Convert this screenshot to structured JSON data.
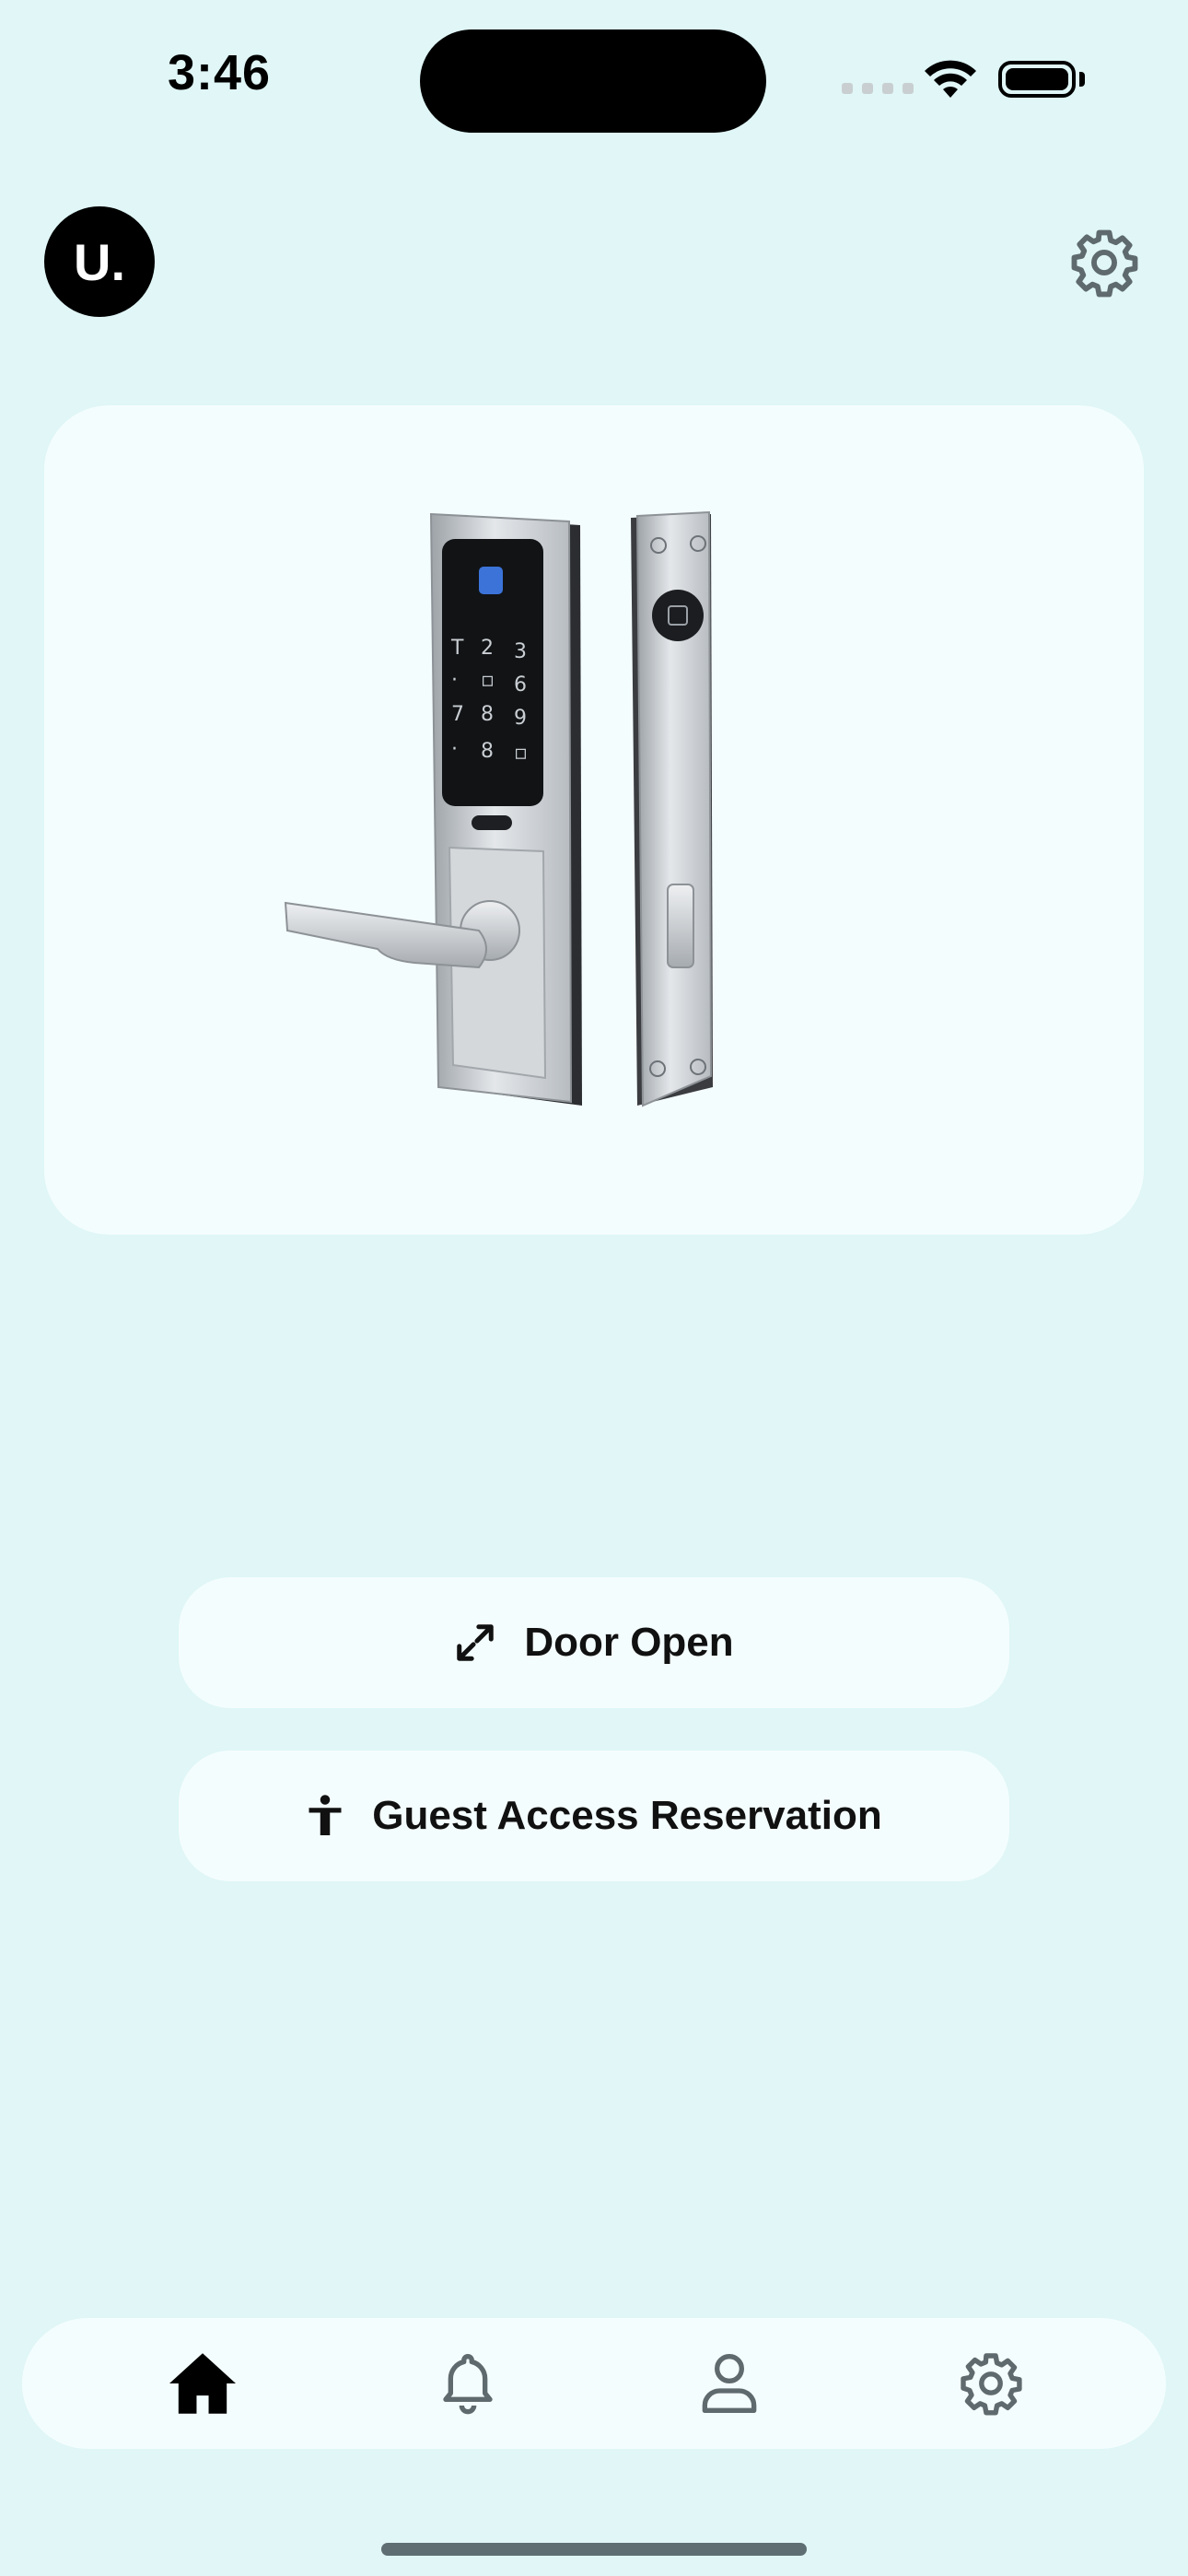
{
  "status_bar": {
    "time": "3:46",
    "signal_icon": "cellular-signal-icon",
    "wifi_icon": "wifi-icon",
    "battery_icon": "battery-icon"
  },
  "header": {
    "avatar_initial": "U.",
    "settings_icon": "gear-icon"
  },
  "product": {
    "image": "smart-door-lock-image"
  },
  "actions": {
    "door_open": {
      "label": "Door Open",
      "icon": "expand-arrows-icon"
    },
    "guest_access": {
      "label": "Guest Access Reservation",
      "icon": "person-icon"
    }
  },
  "tab_bar": {
    "items": [
      {
        "name": "home",
        "icon": "home-icon",
        "active": true
      },
      {
        "name": "notifications",
        "icon": "bell-icon",
        "active": false
      },
      {
        "name": "profile",
        "icon": "user-icon",
        "active": false
      },
      {
        "name": "settings",
        "icon": "gear-icon",
        "active": false
      }
    ]
  },
  "colors": {
    "background": "#e0f6f7",
    "card": "#f4fdfe",
    "text": "#111111",
    "icon_inactive": "#5f6a6e"
  }
}
